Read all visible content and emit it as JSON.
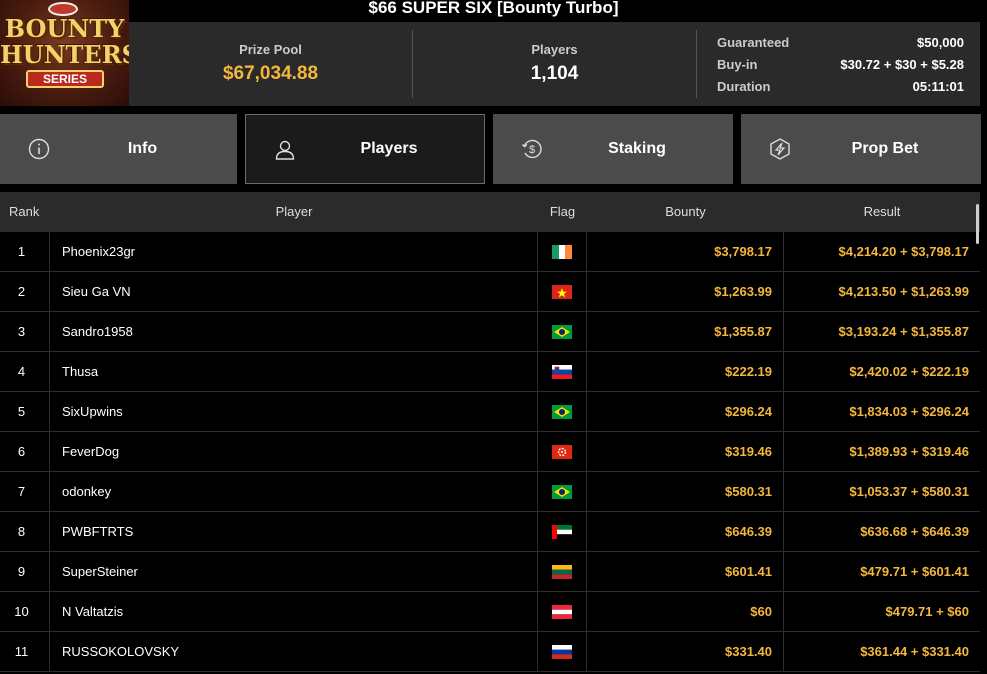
{
  "title": "$66 SUPER SIX [Bounty Turbo]",
  "logo": {
    "line1": "BOUNTY",
    "line2": "HUNTERS",
    "line3": "SERIES"
  },
  "stats": {
    "prize_pool_label": "Prize Pool",
    "prize_pool_value": "$67,034.88",
    "players_label": "Players",
    "players_value": "1,104",
    "details": [
      {
        "label": "Guaranteed",
        "value": "$50,000"
      },
      {
        "label": "Buy-in",
        "value": "$30.72 + $30 + $5.28"
      },
      {
        "label": "Duration",
        "value": "05:11:01"
      }
    ]
  },
  "tabs": [
    {
      "label": "Info",
      "icon": "info-icon",
      "active": false
    },
    {
      "label": "Players",
      "icon": "user-icon",
      "active": true
    },
    {
      "label": "Staking",
      "icon": "dollar-circle-icon",
      "active": false
    },
    {
      "label": "Prop Bet",
      "icon": "hexagon-bolt-icon",
      "active": false
    }
  ],
  "table": {
    "headers": {
      "rank": "Rank",
      "player": "Player",
      "flag": "Flag",
      "bounty": "Bounty",
      "result": "Result"
    },
    "rows": [
      {
        "rank": "1",
        "player": "Phoenix23gr",
        "flag": "ireland",
        "bounty": "$3,798.17",
        "result": "$4,214.20 + $3,798.17"
      },
      {
        "rank": "2",
        "player": "Sieu Ga VN",
        "flag": "vietnam",
        "bounty": "$1,263.99",
        "result": "$4,213.50 + $1,263.99"
      },
      {
        "rank": "3",
        "player": "Sandro1958",
        "flag": "brazil",
        "bounty": "$1,355.87",
        "result": "$3,193.24 + $1,355.87"
      },
      {
        "rank": "4",
        "player": "Thusa",
        "flag": "slovenia",
        "bounty": "$222.19",
        "result": "$2,420.02 + $222.19"
      },
      {
        "rank": "5",
        "player": "SixUpwins",
        "flag": "brazil",
        "bounty": "$296.24",
        "result": "$1,834.03 + $296.24"
      },
      {
        "rank": "6",
        "player": "FeverDog",
        "flag": "hong-kong",
        "bounty": "$319.46",
        "result": "$1,389.93 + $319.46"
      },
      {
        "rank": "7",
        "player": "odonkey",
        "flag": "brazil",
        "bounty": "$580.31",
        "result": "$1,053.37 + $580.31"
      },
      {
        "rank": "8",
        "player": "PWBFTRTS",
        "flag": "uae",
        "bounty": "$646.39",
        "result": "$636.68 + $646.39"
      },
      {
        "rank": "9",
        "player": "SuperSteiner",
        "flag": "lithuania",
        "bounty": "$601.41",
        "result": "$479.71 + $601.41"
      },
      {
        "rank": "10",
        "player": "N Valtatzis",
        "flag": "austria",
        "bounty": "$60",
        "result": "$479.71 + $60"
      },
      {
        "rank": "11",
        "player": "RUSSOKOLOVSKY",
        "flag": "russia",
        "bounty": "$331.40",
        "result": "$361.44 + $331.40"
      }
    ]
  },
  "colors": {
    "accent": "#f5b73b",
    "panel": "#2a2a2a",
    "tab": "#4b4b4b",
    "tab_active": "#1b1b1b"
  }
}
